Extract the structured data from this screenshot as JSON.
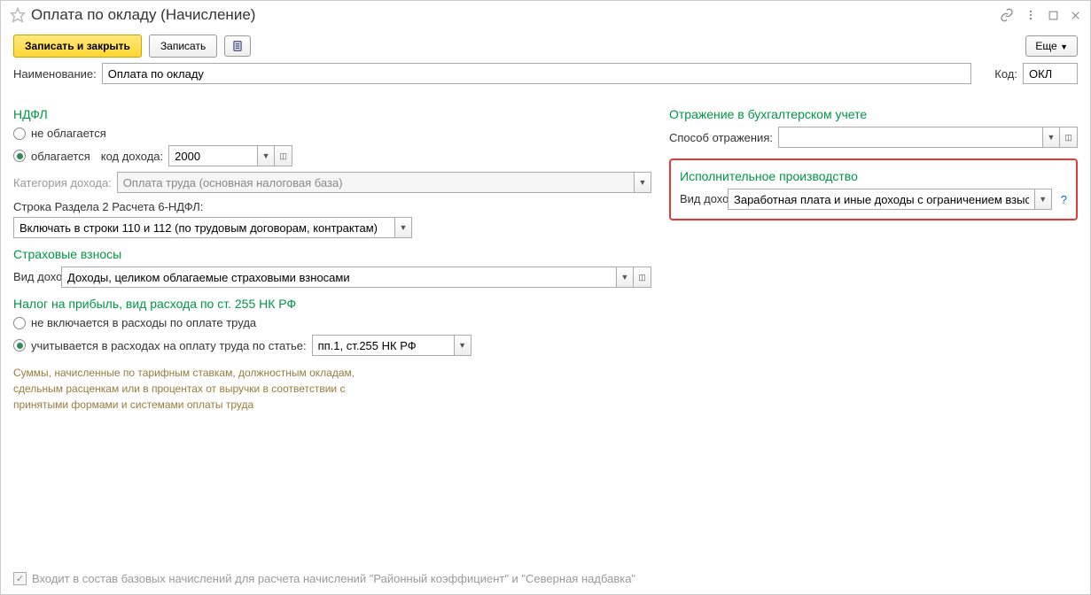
{
  "title": "Оплата по окладу (Начисление)",
  "toolbar": {
    "save_close": "Записать и закрыть",
    "save": "Записать",
    "more": "Еще"
  },
  "fields": {
    "name_label": "Наименование:",
    "name_value": "Оплата по окладу",
    "code_label": "Код:",
    "code_value": "ОКЛ"
  },
  "ndfl": {
    "header": "НДФЛ",
    "not_taxed": "не облагается",
    "taxed": "облагается",
    "income_code_label": "код дохода:",
    "income_code_value": "2000",
    "category_label": "Категория дохода:",
    "category_value": "Оплата труда (основная налоговая база)",
    "section2_label": "Строка Раздела 2 Расчета 6-НДФЛ:",
    "section2_value": "Включать в строки 110 и 112 (по трудовым договорам, контрактам)"
  },
  "insurance": {
    "header": "Страховые взносы",
    "type_label": "Вид дохода:",
    "type_value": "Доходы, целиком облагаемые страховыми взносами"
  },
  "profit_tax": {
    "header": "Налог на прибыль, вид расхода по ст. 255 НК РФ",
    "not_included": "не включается в расходы по оплате труда",
    "included": "учитывается в расходах на оплату труда по статье:",
    "article_value": "пп.1, ст.255 НК РФ",
    "note": "Суммы, начисленные по тарифным ставкам, должностным окладам, сдельным расценкам или в процентах от выручки в соответствии с принятыми формами и системами оплаты труда"
  },
  "accounting": {
    "header": "Отражение в бухгалтерском учете",
    "method_label": "Способ отражения:",
    "method_value": ""
  },
  "enforcement": {
    "header": "Исполнительное производство",
    "type_label": "Вид дохода:",
    "type_value": "Заработная плата и иные доходы с ограничением взыскания"
  },
  "footer": {
    "base_calc": "Входит в состав базовых начислений для расчета начислений \"Районный коэффициент\" и \"Северная надбавка\""
  }
}
